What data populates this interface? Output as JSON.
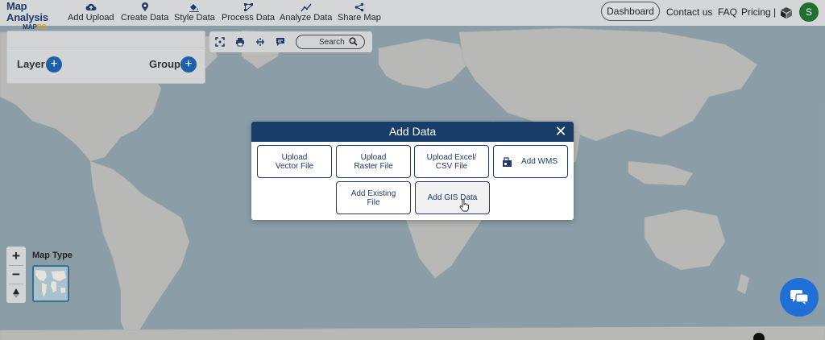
{
  "brand": {
    "name": "Map Analysis",
    "sub_prefix": "MAP",
    "sub_suffix": "RG",
    "accent": "#1f3a6b",
    "gold": "#c9a227"
  },
  "nav": {
    "items": [
      {
        "label": "Add Upload",
        "icon": "cloud-upload-icon"
      },
      {
        "label": "Create Data",
        "icon": "map-pin-icon"
      },
      {
        "label": "Style Data",
        "icon": "paint-bucket-icon"
      },
      {
        "label": "Process Data",
        "icon": "process-nodes-icon"
      },
      {
        "label": "Analyze Data",
        "icon": "analyze-chart-icon"
      },
      {
        "label": "Share Map",
        "icon": "share-icon"
      }
    ],
    "dashboard": "Dashboard",
    "contact": "Contact us",
    "faq": "FAQ",
    "pricing": "Pricing |",
    "avatar_letter": "S"
  },
  "layer_panel": {
    "layer_label": "Layer",
    "group_label": "Group"
  },
  "toolbar": {
    "search_placeholder": "Search"
  },
  "map_controls": {
    "zoom_in": "+",
    "zoom_out": "−",
    "map_type_label": "Map Type"
  },
  "modal": {
    "title": "Add Data",
    "close": "✕",
    "header_color": "#183d68",
    "options": [
      {
        "label": "Upload Vector File"
      },
      {
        "label": "Upload Raster File"
      },
      {
        "label": "Upload Excel/ CSV File"
      },
      {
        "label": "Add WMS"
      },
      {
        "label": "Add Existing File"
      },
      {
        "label": "Add GIS Data"
      }
    ]
  }
}
